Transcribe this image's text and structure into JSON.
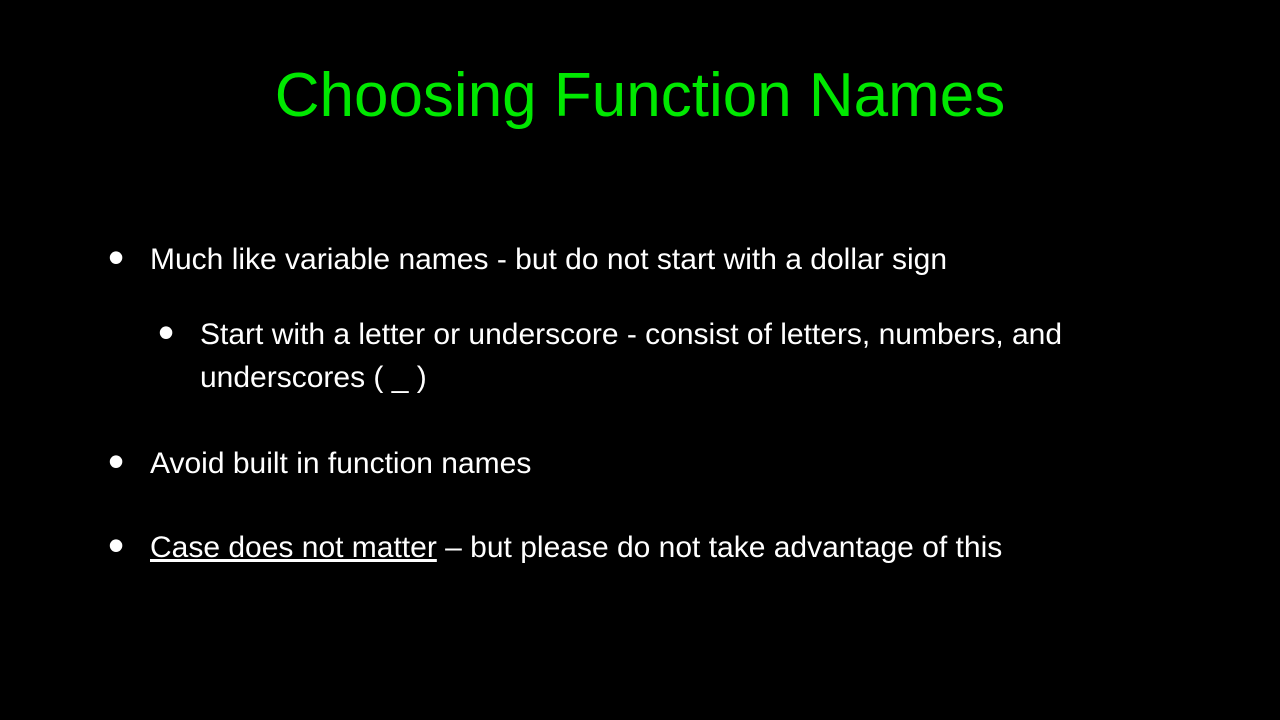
{
  "title": "Choosing Function Names",
  "bullets": {
    "b1": "Much like variable names - but do not start with a dollar sign",
    "b1a": "Start with a letter or underscore - consist of letters, numbers, and underscores ( _ )",
    "b2": "Avoid built in function names",
    "b3_underlined": "Case does not matter",
    "b3_rest": " – but please do not take advantage of this"
  }
}
